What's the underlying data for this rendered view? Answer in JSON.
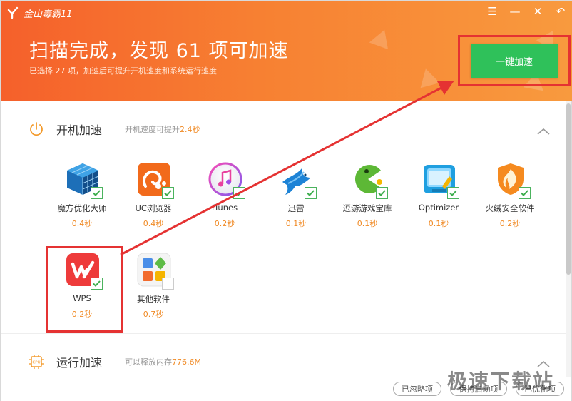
{
  "window": {
    "app_title": "金山毒霸11",
    "controls": [
      "☰",
      "—",
      "✕",
      "↶"
    ]
  },
  "header": {
    "headline": "扫描完成，发现 61 项可加速",
    "subline": "已选择 27 项，加速后可提升开机速度和系统运行速度",
    "one_key_button": "一键加速"
  },
  "boot_section": {
    "title": "开机加速",
    "desc_prefix": "开机速度可提升",
    "desc_value": "2.4秒",
    "apps": [
      {
        "name": "魔方优化大师",
        "time": "0.4秒",
        "icon": "cube-icon",
        "checked": true
      },
      {
        "name": "UC浏览器",
        "time": "0.4秒",
        "icon": "uc-browser-icon",
        "checked": true
      },
      {
        "name": "iTunes",
        "time": "0.2秒",
        "icon": "itunes-icon",
        "checked": true
      },
      {
        "name": "迅雷",
        "time": "0.1秒",
        "icon": "thunder-bird-icon",
        "checked": true
      },
      {
        "name": "逗游游戏宝库",
        "time": "0.1秒",
        "icon": "pacman-icon",
        "checked": true
      },
      {
        "name": "Optimizer",
        "time": "0.1秒",
        "icon": "optimizer-icon",
        "checked": true
      },
      {
        "name": "火绒安全软件",
        "time": "0.2秒",
        "icon": "huorong-shield-icon",
        "checked": true
      },
      {
        "name": "WPS",
        "time": "0.2秒",
        "icon": "wps-icon",
        "checked": true
      },
      {
        "name": "其他软件",
        "time": "0.7秒",
        "icon": "apps-grid-icon",
        "checked": false
      }
    ]
  },
  "run_section": {
    "title": "运行加速",
    "desc_prefix": "可以释放内存",
    "desc_value": "776.6M"
  },
  "bottom": {
    "buttons": [
      "已忽略项",
      "保持启动项",
      "已优化项"
    ]
  },
  "watermark": "极速下载站",
  "colors": {
    "header_start": "#f5602b",
    "header_end": "#f89a3e",
    "primary_button": "#2fc15a",
    "highlight_box": "#e53232",
    "accent_text": "#f08a25"
  }
}
